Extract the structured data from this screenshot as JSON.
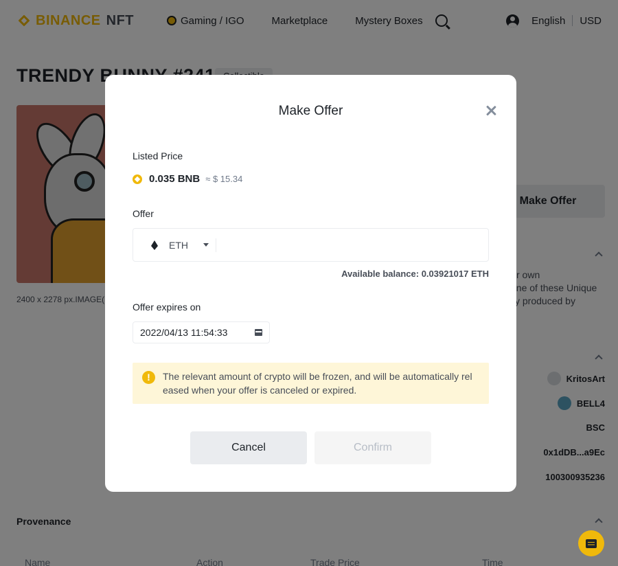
{
  "header": {
    "brand": "BINANCE",
    "brand_suffix": "NFT",
    "nav": [
      "Gaming / IGO",
      "Marketplace",
      "Mystery Boxes"
    ],
    "language": "English",
    "currency": "USD"
  },
  "page": {
    "title": "TRENDY BUNNY #241",
    "badge": "Collectible",
    "image_caption": "2400 x 2278 px.IMAGE(1",
    "make_offer_label": "Make Offer",
    "description_lines": [
      "r own",
      "one of these Unique",
      "y produced by"
    ],
    "creator": "KritosArt",
    "owner": "BELL4",
    "network": "BSC",
    "contract": "0x1dDB...a9Ec",
    "token_id": "100300935236",
    "provenance": {
      "title": "Provenance",
      "columns": [
        "Name",
        "Action",
        "Trade Price",
        "Time"
      ]
    }
  },
  "modal": {
    "title": "Make Offer",
    "listed_price_label": "Listed Price",
    "listed_price": "0.035 BNB",
    "listed_price_usd": "≈ $ 15.34",
    "offer_label": "Offer",
    "token": "ETH",
    "amount_value": "",
    "available_balance": "Available balance: 0.03921017 ETH",
    "expires_label": "Offer expires on",
    "expires_value": "2022/04/13 11:54:33",
    "notice": "The relevant amount of crypto will be frozen, and will be automatically rel eased when your offer is canceled or expired.",
    "cancel_label": "Cancel",
    "confirm_label": "Confirm"
  },
  "colors": {
    "brand_yellow": "#F0B90B",
    "overlay": "rgba(0,0,0,0.5)",
    "notice_bg": "#FEF6D8"
  },
  "icons": [
    "binance-logo-icon",
    "gaming-icon",
    "search-icon",
    "user-icon",
    "close-icon",
    "bnb-icon",
    "eth-icon",
    "caret-down-icon",
    "calendar-icon",
    "warning-icon",
    "chat-icon",
    "chevron-up-icon"
  ]
}
